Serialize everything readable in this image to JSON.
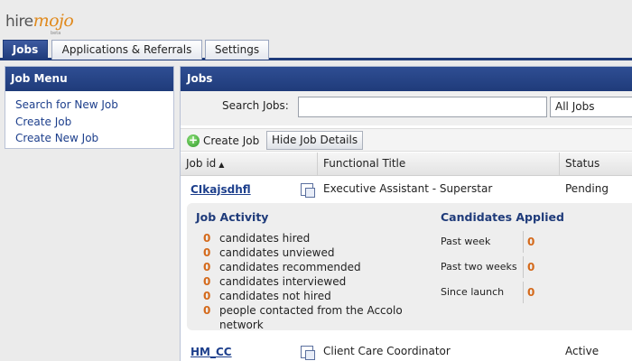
{
  "logo": {
    "hire": "hire",
    "mojo": "mojo",
    "sub": "beta"
  },
  "tabs": [
    {
      "label": "Jobs"
    },
    {
      "label": "Applications & Referrals"
    },
    {
      "label": "Settings"
    }
  ],
  "left_panel": {
    "title": "Job Menu",
    "items": [
      {
        "label": "Search for New Job"
      },
      {
        "label": "Create Job"
      },
      {
        "label": "Create New Job"
      }
    ]
  },
  "main": {
    "title": "Jobs",
    "search_label": "Search Jobs:",
    "search_value": "",
    "filter_selected": "All Jobs",
    "create_job_label": "Create Job",
    "hide_details_label": "Hide Job Details",
    "columns": {
      "id": "Job id",
      "title": "Functional Title",
      "status": "Status"
    },
    "sort_indicator": "▲",
    "rows": [
      {
        "id": "CIkajsdhfl",
        "title": "Executive Assistant - Superstar",
        "status": "Pending"
      },
      {
        "id": "HM_CC",
        "title": "Client Care Coordinator",
        "status": "Active"
      }
    ],
    "details": {
      "activity_title": "Job Activity",
      "activity": [
        {
          "count": "0",
          "label": "candidates hired"
        },
        {
          "count": "0",
          "label": "candidates unviewed"
        },
        {
          "count": "0",
          "label": "candidates recommended"
        },
        {
          "count": "0",
          "label": "candidates interviewed"
        },
        {
          "count": "0",
          "label": "candidates not hired"
        },
        {
          "count": "0",
          "label": "people contacted from the Accolo network"
        }
      ],
      "applied_title": "Candidates Applied",
      "applied": [
        {
          "label": "Past week",
          "count": "0"
        },
        {
          "label": "Past two weeks",
          "count": "0"
        },
        {
          "label": "Since launch",
          "count": "0"
        }
      ]
    }
  },
  "colors": {
    "header_blue": "#1f3b7a",
    "link_blue": "#1d3f8c",
    "count_orange": "#d4691a",
    "logo_orange": "#e08a1e"
  }
}
